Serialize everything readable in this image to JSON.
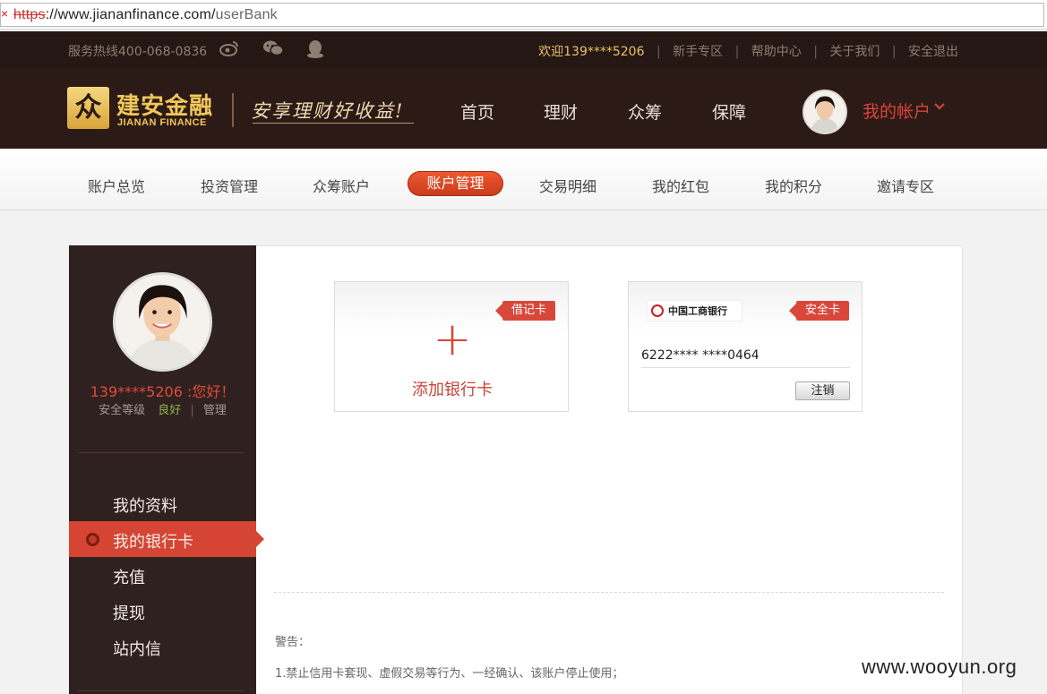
{
  "browser": {
    "url_x": "×",
    "url_scheme": "https",
    "url_rest": "://www.jiananfinance.com/",
    "url_path": "userBank"
  },
  "topbar": {
    "hotline": "服务热线400-068-0836",
    "social_icons": [
      "weibo-icon",
      "wechat-icon",
      "qq-icon"
    ],
    "welcome": "欢迎139****5206",
    "links": [
      "新手专区",
      "帮助中心",
      "关于我们",
      "安全退出"
    ]
  },
  "header": {
    "logo_mark": "众",
    "logo_cn": "建安金融",
    "logo_en": "JIANAN FINANCE",
    "slogan": "安享理财好收益!",
    "nav": [
      "首页",
      "理财",
      "众筹",
      "保障"
    ],
    "my_account": "我的帐户"
  },
  "subnav": {
    "items": [
      "账户总览",
      "投资管理",
      "众筹账户",
      "账户管理",
      "交易明细",
      "我的红包",
      "我的积分",
      "邀请专区"
    ],
    "active": "账户管理"
  },
  "sidebar": {
    "greeting": "139****5206 :您好！",
    "security_label": "安全等级",
    "security_value": "良好",
    "manage": "管理",
    "menu": [
      "我的资料",
      "我的银行卡",
      "充值",
      "提现",
      "站内信"
    ],
    "active": "我的银行卡"
  },
  "cards": {
    "add": {
      "tag": "借记卡",
      "plus": "+",
      "label": "添加银行卡"
    },
    "bank": {
      "tag": "安全卡",
      "bank_name": "中国工商银行",
      "card_number": "6222**** ****0464",
      "cancel": "注销"
    }
  },
  "notice": {
    "title": "警告：",
    "line1": "1.禁止信用卡套现、虚假交易等行为、一经确认、该账户停止使用；"
  },
  "colors": {
    "accent_red": "#d9473a",
    "header_bg": "#2c1a16",
    "gold": "#f0c85a"
  },
  "watermark": "www.wooyun.org"
}
